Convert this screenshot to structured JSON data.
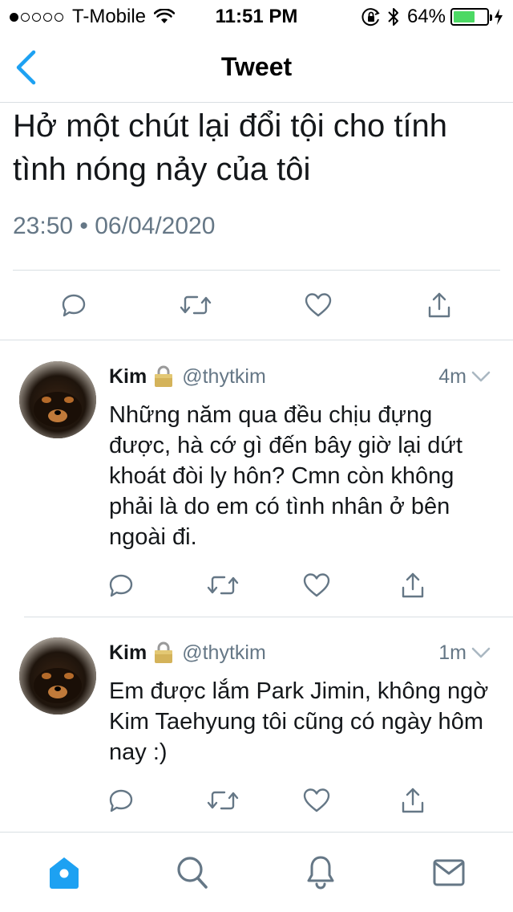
{
  "status_bar": {
    "carrier": "T-Mobile",
    "time": "11:51 PM",
    "battery_percent_label": "64%",
    "battery_level": 0.64,
    "signal_bars_filled": 1,
    "signal_bars_total": 5
  },
  "nav": {
    "title": "Tweet",
    "back_icon": "chevron-left-icon"
  },
  "main_tweet": {
    "text": "Hở một chút lại đổi tội cho tính tình nóng nảy của tôi",
    "timestamp": "23:50 • 06/04/2020",
    "actions": [
      "reply-icon",
      "retweet-icon",
      "like-icon",
      "share-icon"
    ]
  },
  "replies": [
    {
      "name": "Kim",
      "handle": "@thytkim",
      "time": "4m",
      "text": "Những năm qua đều chịu đựng được, hà cớ gì đến bây giờ lại dứt khoát đòi ly hôn? Cmn còn không phải là do em có tình nhân ở bên ngoài đi."
    },
    {
      "name": "Kim",
      "handle": "@thytkim",
      "time": "1m",
      "text": "Em được lắm Park Jimin, không ngờ Kim Taehyung tôi cũng có ngày hôm nay :)"
    }
  ],
  "tab_bar": {
    "tabs": [
      "home-icon",
      "search-icon",
      "notifications-icon",
      "messages-icon"
    ],
    "active": "home-icon"
  },
  "colors": {
    "accent": "#1da1f2",
    "text_primary": "#14171a",
    "text_secondary": "#657786",
    "icon_gray": "#657786",
    "divider": "#d9dfe3",
    "battery_green": "#4cd964"
  }
}
